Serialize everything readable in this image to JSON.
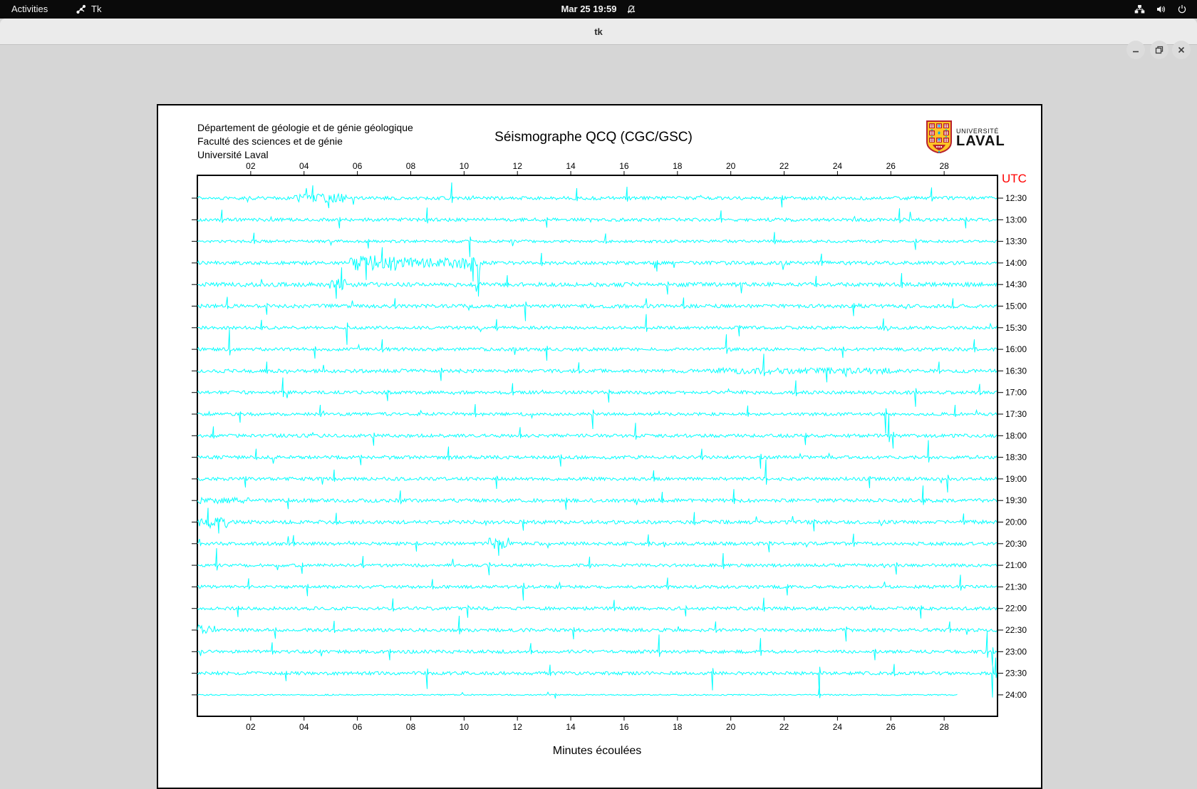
{
  "topbar": {
    "activities": "Activities",
    "app_name": "Tk",
    "clock": "Mar 25 19:59"
  },
  "titlebar": {
    "title": "tk"
  },
  "canvas": {
    "header_lines": [
      "Département de géologie et de génie géologique",
      "Faculté des sciences et de génie",
      "Université Laval"
    ],
    "title": "Séismographe QCQ (CGC/GSC)",
    "utc_label": "UTC",
    "xlabel": "Minutes écoulées",
    "logo": {
      "line1": "UNIVERSITÉ",
      "line2": "LAVAL"
    }
  },
  "chart_data": {
    "type": "line",
    "title": "Séismographe QCQ (CGC/GSC)",
    "xlabel": "Minutes écoulées",
    "x_range": [
      0,
      30
    ],
    "x_ticks": [
      "02",
      "04",
      "06",
      "08",
      "10",
      "12",
      "14",
      "16",
      "18",
      "20",
      "22",
      "24",
      "26",
      "28"
    ],
    "utc_label": "UTC",
    "trace_color": "#00ffff",
    "axis_color": "#000000",
    "utc_color": "#ff0000",
    "grid": false,
    "rows": [
      {
        "label": "12:30",
        "end": 30,
        "amp": 2.4,
        "events": [
          [
            3.6,
            5.6,
            6
          ]
        ],
        "spikes": [
          [
            4.3,
            18
          ],
          [
            4.9,
            -14
          ],
          [
            9.5,
            22
          ],
          [
            14.2,
            14
          ],
          [
            16.1,
            16
          ],
          [
            21.9,
            -13
          ],
          [
            27.5,
            15
          ]
        ]
      },
      {
        "label": "13:00",
        "end": 30,
        "amp": 2.4,
        "events": [],
        "spikes": [
          [
            0.9,
            14
          ],
          [
            5.3,
            -12
          ],
          [
            8.6,
            17
          ],
          [
            13.1,
            -11
          ],
          [
            19.6,
            13
          ],
          [
            26.3,
            16
          ],
          [
            28.8,
            -12
          ]
        ]
      },
      {
        "label": "13:30",
        "end": 30,
        "amp": 2.0,
        "events": [],
        "spikes": [
          [
            2.1,
            12
          ],
          [
            6.4,
            -10
          ],
          [
            10.2,
            -22
          ],
          [
            15.3,
            11
          ],
          [
            21.6,
            13
          ],
          [
            26.9,
            -12
          ]
        ]
      },
      {
        "label": "14:00",
        "end": 30,
        "amp": 2.6,
        "events": [
          [
            5.7,
            7.8,
            11
          ],
          [
            7.8,
            10.4,
            7
          ],
          [
            10.0,
            10.6,
            13
          ]
        ],
        "spikes": [
          [
            6.3,
            -24
          ],
          [
            6.9,
            22
          ],
          [
            10.3,
            -26
          ],
          [
            12.9,
            14
          ],
          [
            17.2,
            -12
          ],
          [
            23.4,
            13
          ]
        ]
      },
      {
        "label": "14:30",
        "end": 30,
        "amp": 3.0,
        "events": [
          [
            4.9,
            5.6,
            8
          ]
        ],
        "spikes": [
          [
            5.2,
            -20
          ],
          [
            5.4,
            24
          ],
          [
            11.6,
            13
          ],
          [
            17.6,
            -14
          ],
          [
            23.2,
            12
          ],
          [
            26.4,
            16
          ]
        ]
      },
      {
        "label": "15:00",
        "end": 30,
        "amp": 2.6,
        "events": [],
        "spikes": [
          [
            1.1,
            13
          ],
          [
            2.6,
            -12
          ],
          [
            7.4,
            11
          ],
          [
            12.3,
            -21
          ],
          [
            18.2,
            12
          ],
          [
            24.6,
            -14
          ],
          [
            28.3,
            11
          ]
        ]
      },
      {
        "label": "15:30",
        "end": 30,
        "amp": 2.2,
        "events": [],
        "spikes": [
          [
            2.4,
            11
          ],
          [
            5.6,
            -24
          ],
          [
            11.2,
            12
          ],
          [
            16.8,
            19
          ],
          [
            20.3,
            -12
          ],
          [
            25.7,
            13
          ]
        ]
      },
      {
        "label": "16:00",
        "end": 30,
        "amp": 2.4,
        "events": [],
        "spikes": [
          [
            1.2,
            28
          ],
          [
            4.4,
            -13
          ],
          [
            6.9,
            14
          ],
          [
            13.1,
            -16
          ],
          [
            19.8,
            21
          ],
          [
            24.2,
            -12
          ],
          [
            29.1,
            14
          ]
        ]
      },
      {
        "label": "16:30",
        "end": 30,
        "amp": 2.6,
        "events": [
          [
            19.5,
            26,
            4.5
          ]
        ],
        "spikes": [
          [
            2.6,
            13
          ],
          [
            9.1,
            -14
          ],
          [
            14.3,
            12
          ],
          [
            21.2,
            24
          ],
          [
            23.6,
            -16
          ],
          [
            27.8,
            13
          ]
        ]
      },
      {
        "label": "17:00",
        "end": 30,
        "amp": 2.4,
        "events": [],
        "spikes": [
          [
            3.2,
            21
          ],
          [
            7.1,
            -12
          ],
          [
            11.8,
            13
          ],
          [
            15.4,
            -14
          ],
          [
            22.4,
            17
          ],
          [
            26.9,
            -20
          ],
          [
            29.3,
            12
          ]
        ]
      },
      {
        "label": "17:30",
        "end": 30,
        "amp": 2.2,
        "events": [],
        "spikes": [
          [
            1.6,
            -12
          ],
          [
            4.6,
            13
          ],
          [
            10.4,
            14
          ],
          [
            14.8,
            -21
          ],
          [
            20.6,
            12
          ],
          [
            25.8,
            -27
          ],
          [
            28.4,
            13
          ]
        ]
      },
      {
        "label": "18:00",
        "end": 30,
        "amp": 2.4,
        "events": [],
        "spikes": [
          [
            0.6,
            13
          ],
          [
            6.6,
            -14
          ],
          [
            12.1,
            12
          ],
          [
            16.4,
            18
          ],
          [
            22.8,
            -13
          ],
          [
            25.9,
            30
          ],
          [
            26.05,
            -18
          ]
        ]
      },
      {
        "label": "18:30",
        "end": 30,
        "amp": 2.4,
        "events": [],
        "spikes": [
          [
            2.2,
            12
          ],
          [
            6.1,
            -11
          ],
          [
            9.4,
            15
          ],
          [
            13.6,
            -13
          ],
          [
            18.9,
            12
          ],
          [
            21.1,
            -16
          ],
          [
            27.4,
            24
          ]
        ]
      },
      {
        "label": "19:00",
        "end": 30,
        "amp": 2.4,
        "events": [],
        "spikes": [
          [
            1.8,
            -12
          ],
          [
            5.1,
            13
          ],
          [
            11.2,
            -14
          ],
          [
            17.1,
            12
          ],
          [
            21.3,
            27
          ],
          [
            25.2,
            -13
          ],
          [
            28.1,
            -19
          ]
        ]
      },
      {
        "label": "19:30",
        "end": 30,
        "amp": 2.6,
        "events": [
          [
            0,
            2.1,
            4.5
          ]
        ],
        "spikes": [
          [
            3.4,
            -12
          ],
          [
            7.6,
            14
          ],
          [
            13.8,
            -13
          ],
          [
            17.4,
            12
          ],
          [
            20.1,
            16
          ],
          [
            27.2,
            21
          ]
        ]
      },
      {
        "label": "20:00",
        "end": 30,
        "amp": 2.6,
        "events": [
          [
            0,
            1.2,
            9
          ]
        ],
        "spikes": [
          [
            0.4,
            20
          ],
          [
            0.8,
            -16
          ],
          [
            5.2,
            13
          ],
          [
            12.2,
            -12
          ],
          [
            18.6,
            14
          ],
          [
            23.1,
            -13
          ],
          [
            28.7,
            12
          ]
        ]
      },
      {
        "label": "20:30",
        "end": 30,
        "amp": 2.4,
        "events": [
          [
            10.9,
            11.7,
            9
          ]
        ],
        "spikes": [
          [
            3.6,
            12
          ],
          [
            8.2,
            -11
          ],
          [
            11.3,
            -17
          ],
          [
            16.9,
            13
          ],
          [
            21.4,
            -12
          ],
          [
            24.6,
            14
          ]
        ]
      },
      {
        "label": "21:00",
        "end": 30,
        "amp": 2.2,
        "events": [],
        "spikes": [
          [
            0.7,
            24
          ],
          [
            3.9,
            -12
          ],
          [
            6.2,
            13
          ],
          [
            10.9,
            -14
          ],
          [
            14.7,
            12
          ],
          [
            19.7,
            17
          ],
          [
            26.2,
            -13
          ]
        ]
      },
      {
        "label": "21:30",
        "end": 30,
        "amp": 2.2,
        "events": [],
        "spikes": [
          [
            1.9,
            12
          ],
          [
            4.1,
            -13
          ],
          [
            8.8,
            11
          ],
          [
            12.2,
            -19
          ],
          [
            17.6,
            13
          ],
          [
            22.1,
            -12
          ],
          [
            28.6,
            17
          ]
        ]
      },
      {
        "label": "22:00",
        "end": 30,
        "amp": 2.4,
        "events": [],
        "spikes": [
          [
            1.5,
            -12
          ],
          [
            7.3,
            14
          ],
          [
            10.1,
            -13
          ],
          [
            15.6,
            12
          ],
          [
            18.3,
            -11
          ],
          [
            21.2,
            15
          ],
          [
            27.1,
            -14
          ]
        ]
      },
      {
        "label": "22:30",
        "end": 30,
        "amp": 2.4,
        "events": [
          [
            0,
            0.7,
            7
          ]
        ],
        "spikes": [
          [
            2.9,
            -12
          ],
          [
            5.1,
            13
          ],
          [
            9.8,
            20
          ],
          [
            14.1,
            -13
          ],
          [
            19.4,
            12
          ],
          [
            24.3,
            -16
          ],
          [
            28.2,
            12
          ]
        ]
      },
      {
        "label": "23:00",
        "end": 30,
        "amp": 2.4,
        "events": [],
        "spikes": [
          [
            2.8,
            13
          ],
          [
            7.2,
            -12
          ],
          [
            12.5,
            12
          ],
          [
            17.3,
            24
          ],
          [
            21.1,
            19
          ],
          [
            25.4,
            -12
          ],
          [
            29.6,
            28
          ],
          [
            29.8,
            -20
          ]
        ]
      },
      {
        "label": "23:30",
        "end": 30,
        "amp": 2.4,
        "events": [],
        "spikes": [
          [
            3.3,
            -11
          ],
          [
            8.6,
            -22
          ],
          [
            13.2,
            12
          ],
          [
            19.3,
            -24
          ],
          [
            23.3,
            -30
          ],
          [
            26.1,
            13
          ],
          [
            29.8,
            -34
          ],
          [
            29.9,
            22
          ]
        ]
      },
      {
        "label": "24:00",
        "end": 28.5,
        "amp": 0.9,
        "events": [],
        "spikes": [
          [
            13.4,
            -5
          ],
          [
            23.3,
            15
          ]
        ]
      }
    ]
  }
}
